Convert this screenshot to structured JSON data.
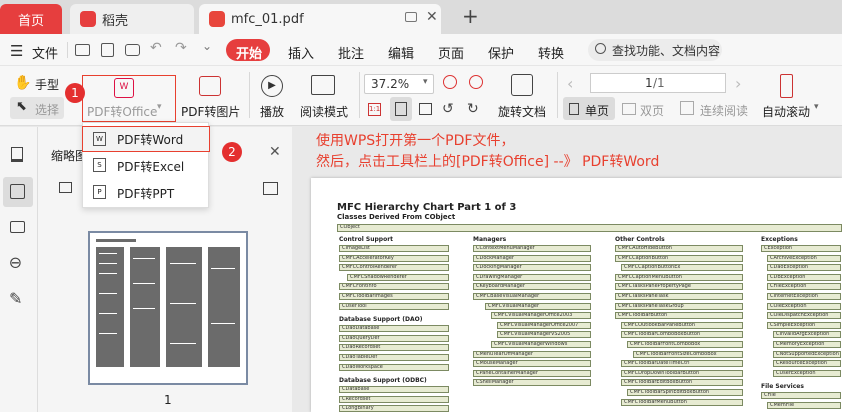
{
  "tabs": {
    "home": "首页",
    "docer": "稻壳",
    "pdf": "mfc_01.pdf",
    "add": "+"
  },
  "toolbar": {
    "file_menu": "文件",
    "menus": [
      "开始",
      "插入",
      "批注",
      "编辑",
      "页面",
      "保护",
      "转换"
    ],
    "search_placeholder": "查找功能、文档内容"
  },
  "ribbon": {
    "hand": "手型",
    "select": "选择",
    "pdf_to_office": "PDF转Office",
    "pdf_to_image": "PDF转图片",
    "play": "播放",
    "read_mode": "阅读模式",
    "zoom": "37.2%",
    "rotate": "旋转文档",
    "page_value": "1",
    "page_total": "/1",
    "single_page": "单页",
    "double_page": "双页",
    "continuous": "连续阅读",
    "auto_scroll": "自动滚动"
  },
  "dropdown": {
    "items": [
      "PDF转Word",
      "PDF转Excel",
      "PDF转PPT"
    ]
  },
  "badges": {
    "one": "1",
    "two": "2"
  },
  "panel": {
    "title": "缩略图",
    "page_number": "1"
  },
  "annotation": {
    "line1": "使用WPS打开第一个PDF文件，",
    "line2": "然后，点击工具栏上的[PDF转Office] --》 PDF转Word"
  },
  "document": {
    "title": "MFC Hierarchy Chart Part 1 of 3",
    "subtitle": "Classes Derived From CObject",
    "root": "CObject",
    "columns": [
      {
        "sections": [
          {
            "heading": "Control Support",
            "items": [
              "CImageList",
              "CMFCAcceleratorKey",
              "CMFCControlRenderer",
              "CMFCShadowRenderer",
              "CMFCFontInfo",
              "CMFCToolBarImages",
              "CUserTool"
            ]
          },
          {
            "heading": "Database Support (DAO)",
            "items": [
              "CDaoDatabase",
              "CDaoQueryDef",
              "CDaoRecordset",
              "CDaoTableDef",
              "CDaoWorkspace"
            ]
          },
          {
            "heading": "Database Support (ODBC)",
            "items": [
              "CDatabase",
              "CRecordset",
              "CLongBinary"
            ]
          }
        ]
      },
      {
        "sections": [
          {
            "heading": "Managers",
            "items": [
              "CContextMenuManager",
              "CDockManager",
              "CDockingManager",
              "CDrawingManager",
              "CKeyboardManager",
              "CMFCBaseVisualManager",
              "CMFCVisualManager",
              "CMFCVisualManagerOffice2003",
              "CMFCVisualManagerOffice2007",
              "CMFCVisualManagerVS2005",
              "CMFCVisualManagerWindows",
              "CMenuTearOffManager",
              "CMouseManager",
              "CPaneContainerManager",
              "CShellManager"
            ]
          }
        ]
      },
      {
        "sections": [
          {
            "heading": "Other Controls",
            "items": [
              "CMFCAutoHideButton",
              "CMFCCaptionButton",
              "CMFCCaptionButtonEx",
              "CMFCCaptionMenuButton",
              "CMFCTasksPanePropertyPage",
              "CMFCTasksPaneTask",
              "CMFCTasksPaneTaskGroup",
              "CMFCToolBarButton",
              "CMFCOutlookBarPaneButton",
              "CMFCToolBarComboBoxButton",
              "CMFCToolBarFontComboBox",
              "CMFCToolBarFontSizeComboBox",
              "CMFCToolBarDateTimeCtrl",
              "CMFCDropDownToolbarButton",
              "CMFCToolBarEditBoxButton",
              "CMFCToolBarSpinEditBoxButton",
              "CMFCToolBarMenuButton"
            ]
          }
        ]
      },
      {
        "sections": [
          {
            "heading": "Exceptions",
            "items": [
              "CException",
              "CArchiveException",
              "CDaoException",
              "CDBException",
              "CFileException",
              "CInternetException",
              "COleException",
              "COleDispatchException",
              "CSimpleException",
              "CInvalidArgException",
              "CMemoryException",
              "CNotSupportedException",
              "CResourceException",
              "CUserException"
            ]
          },
          {
            "heading": "File Services",
            "items": [
              "CFile",
              "CMemFile"
            ]
          }
        ]
      }
    ]
  },
  "colors": {
    "accent": "#e63e3e",
    "highlight_border": "#e8402f",
    "annotation": "#e8402f",
    "box_fill": "#e7ebd2",
    "box_border": "#7c8a62"
  }
}
